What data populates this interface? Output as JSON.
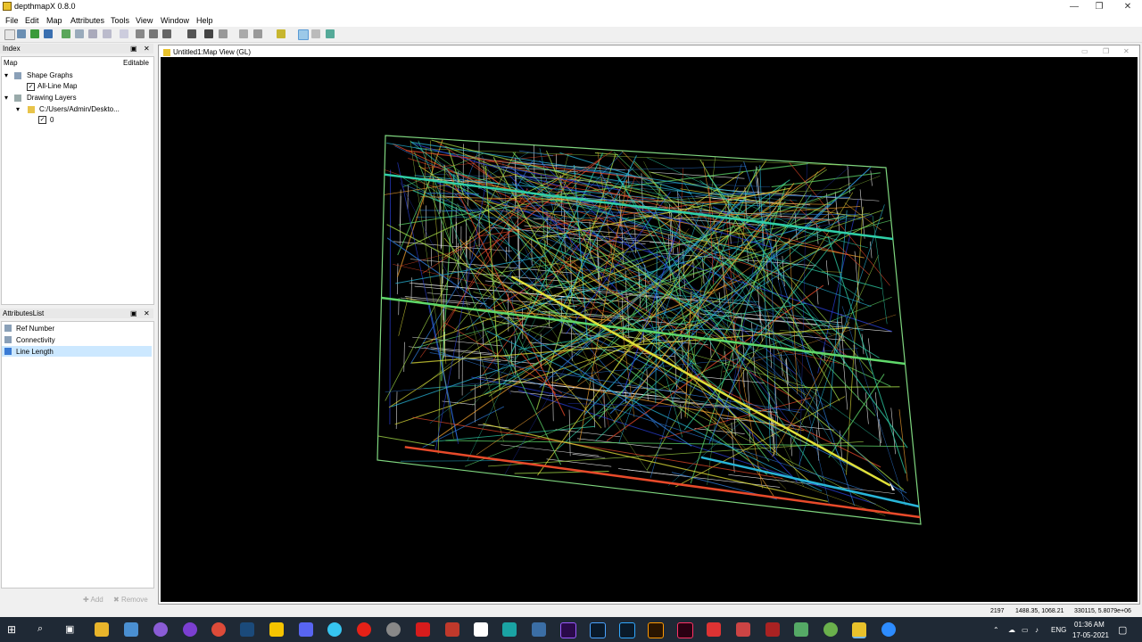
{
  "window": {
    "title": "depthmapX 0.8.0",
    "minimize": "—",
    "maximize": "❐",
    "close": "✕"
  },
  "menu": [
    "File",
    "Edit",
    "Map",
    "Attributes",
    "Tools",
    "View",
    "Window",
    "Help"
  ],
  "index_panel": {
    "title": "Index",
    "pin": "▣",
    "close": "✕",
    "col_map": "Map",
    "col_editable": "Editable",
    "tree": {
      "shape_graphs": "Shape Graphs",
      "all_line_map": "All-Line Map",
      "drawing_layers": "Drawing Layers",
      "folder": "C:/Users/Admin/Deskto...",
      "layer": "0"
    }
  },
  "attributes_panel": {
    "title": "AttributesList",
    "pin": "▣",
    "close": "✕",
    "items": [
      "Ref Number",
      "Connectivity",
      "Line Length"
    ],
    "selected": "Line Length",
    "add": "Add",
    "remove": "Remove"
  },
  "map_view": {
    "title": "Untitled1:Map View (GL)"
  },
  "status": {
    "count": "2197",
    "coords": "1488.35, 1068.21",
    "extra": "330115, 5.8079e+06"
  },
  "taskbar": {
    "lang": "ENG",
    "time": "01:36 AM",
    "date": "17-05-2021"
  },
  "colors": {
    "accent_select": "#cce8ff",
    "map_bg": "#000000",
    "taskbar": "#1f2935"
  }
}
